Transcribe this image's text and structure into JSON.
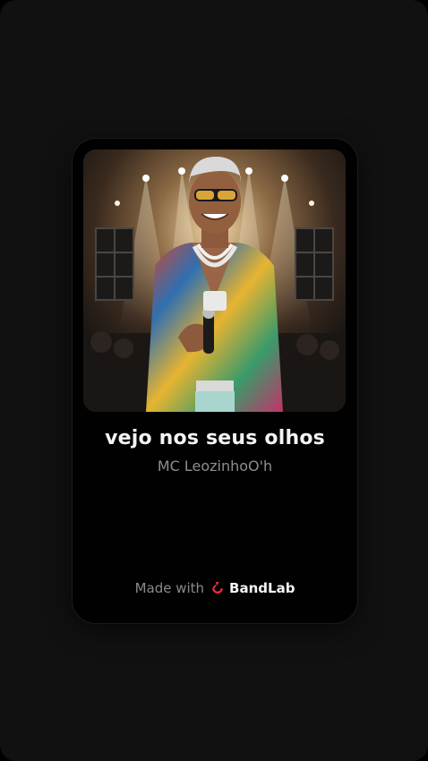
{
  "track": {
    "title": "vejo nos seus olhos",
    "artist": "MC LeozinhoO'h",
    "cover_icon": "album-cover-artist-photo"
  },
  "footer": {
    "made_with_label": "Made with",
    "brand_name": "BandLab",
    "brand_icon": "bandlab-logo-icon",
    "brand_color": "#f02c3b"
  },
  "colors": {
    "background": "#111112",
    "card": "#010101",
    "title": "#f4f4f4",
    "subtitle": "#8e8e90"
  }
}
